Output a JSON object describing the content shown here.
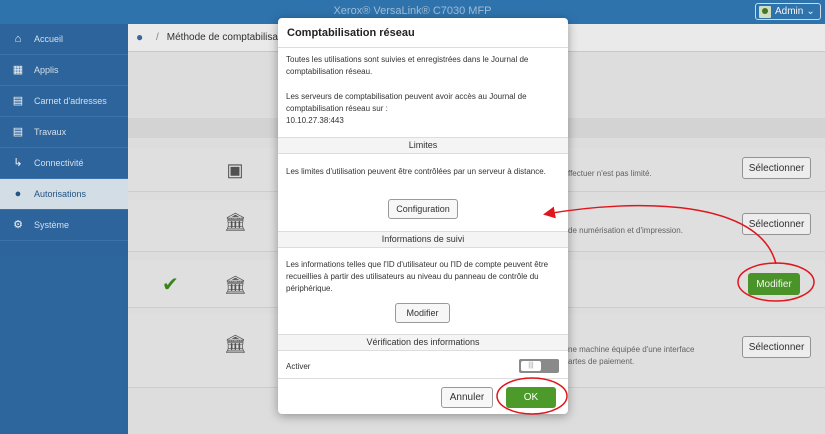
{
  "window_title": "Xerox® VersaLink® C7030 MFP",
  "user": {
    "label": "Admin"
  },
  "sidebar": {
    "items": [
      {
        "label": "Accueil",
        "icon": "home-icon"
      },
      {
        "label": "Applis",
        "icon": "apps-icon"
      },
      {
        "label": "Carnet d'adresses",
        "icon": "address-book-icon"
      },
      {
        "label": "Travaux",
        "icon": "jobs-icon"
      },
      {
        "label": "Connectivité",
        "icon": "connectivity-icon"
      },
      {
        "label": "Autorisations",
        "icon": "permissions-icon",
        "active": true
      },
      {
        "label": "Système",
        "icon": "gear-icon"
      }
    ]
  },
  "breadcrumb": {
    "current": "Méthode de comptabilisa"
  },
  "rows": [
    {
      "desc": "ffectuer n'est pas limité.",
      "button": "Sélectionner"
    },
    {
      "desc": "de numérisation et d'impression.",
      "button": "Sélectionner"
    },
    {
      "desc": "",
      "button": "Modifier"
    },
    {
      "desc_lines": [
        "ne machine équipée d'une interface",
        "artes de paiement."
      ],
      "button": "Sélectionner"
    }
  ],
  "modal": {
    "title": "Comptabilisation réseau",
    "intro_1": "Toutes les utilisations sont suivies et enregistrées dans le Journal de comptabilisation réseau.",
    "intro_2": "Les serveurs de comptabilisation peuvent avoir accès au Journal de comptabilisation réseau sur :",
    "server_address": "10.10.27.38:443",
    "limits": {
      "heading": "Limites",
      "text": "Les limites d'utilisation peuvent être contrôlées par un serveur à distance.",
      "button": "Configuration"
    },
    "tracking": {
      "heading": "Informations de suivi",
      "text": "Les informations telles que l'ID d'utilisateur ou l'ID de compte peuvent être recueillies à partir des utilisateurs au niveau du panneau de contrôle du périphérique.",
      "button": "Modifier"
    },
    "verification": {
      "heading": "Vérification des informations",
      "toggle_label": "Activer",
      "toggle_on": false
    },
    "cancel_label": "Annuler",
    "ok_label": "OK"
  },
  "colors": {
    "topbar": "#3178b5",
    "sidebar": "#2f69a3",
    "primary_green": "#4c9a2a",
    "annotation_red": "#e0161d"
  }
}
